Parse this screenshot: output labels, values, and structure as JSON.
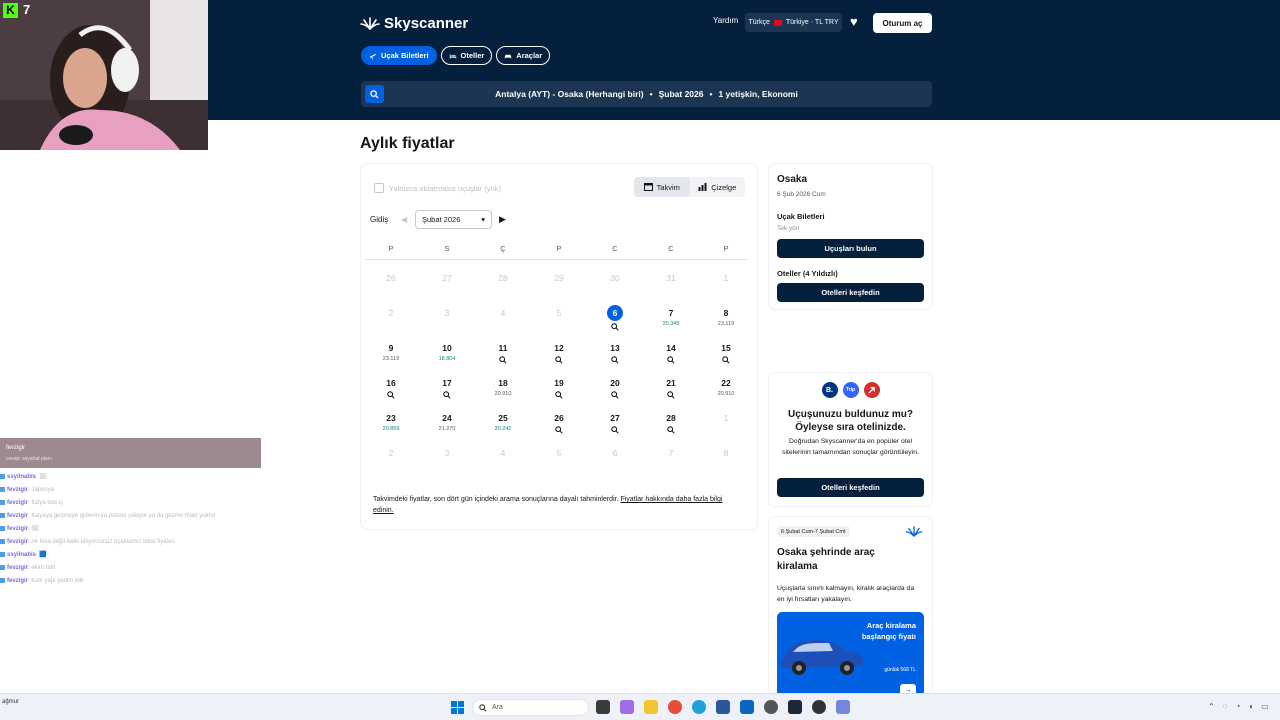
{
  "header": {
    "logo_text": "Skyscanner",
    "help_label": "Yardım",
    "locale_label": "Türkçe",
    "locale_region": "Türkiye · TL TRY",
    "login_label": "Oturum aç",
    "tabs": [
      {
        "label": "Uçak Biletleri",
        "active": true
      },
      {
        "label": "Oteller",
        "active": false
      },
      {
        "label": "Araçlar",
        "active": false
      }
    ],
    "search": {
      "route": "Antalya (AYT) - Osaka (Herhangi biri)",
      "date": "Şubat 2026",
      "travelers": "1 yetişkin, Ekonomi"
    }
  },
  "page_title": "Aylık fiyatlar",
  "calendar": {
    "direct_only_label": "Yalnızca aktarmasız uçuşlar (yok)",
    "view_calendar_label": "Takvim",
    "view_chart_label": "Çizelge",
    "departure_label": "Gidiş",
    "month_value": "Şubat 2026",
    "weekdays": [
      "P",
      "S",
      "Ç",
      "P",
      "C",
      "C",
      "P"
    ],
    "weeks": [
      [
        {
          "d": "26",
          "m": 1
        },
        {
          "d": "27",
          "m": 1
        },
        {
          "d": "28",
          "m": 1
        },
        {
          "d": "29",
          "m": 1
        },
        {
          "d": "30",
          "m": 1
        },
        {
          "d": "31",
          "m": 1
        },
        {
          "d": "1",
          "m": 1
        }
      ],
      [
        {
          "d": "2",
          "m": 1
        },
        {
          "d": "3",
          "m": 1
        },
        {
          "d": "4",
          "m": 1
        },
        {
          "d": "5",
          "m": 1
        },
        {
          "d": "6",
          "s": 1,
          "i": 1
        },
        {
          "d": "7",
          "p": "20.345",
          "c": 1
        },
        {
          "d": "8",
          "p": "23.119"
        }
      ],
      [
        {
          "d": "9",
          "p": "23.119"
        },
        {
          "d": "10",
          "p": "18.804",
          "c": 1
        },
        {
          "d": "11",
          "i": 1
        },
        {
          "d": "12",
          "i": 1
        },
        {
          "d": "13",
          "i": 1
        },
        {
          "d": "14",
          "i": 1
        },
        {
          "d": "15",
          "i": 1
        }
      ],
      [
        {
          "d": "16",
          "i": 1
        },
        {
          "d": "17",
          "i": 1
        },
        {
          "d": "18",
          "p": "20.910"
        },
        {
          "d": "19",
          "i": 1
        },
        {
          "d": "20",
          "i": 1
        },
        {
          "d": "21",
          "i": 1
        },
        {
          "d": "22",
          "p": "20.910"
        }
      ],
      [
        {
          "d": "23",
          "p": "20.859",
          "c": 1
        },
        {
          "d": "24",
          "p": "21.270"
        },
        {
          "d": "25",
          "p": "20.242",
          "c": 1
        },
        {
          "d": "26",
          "i": 1
        },
        {
          "d": "27",
          "i": 1
        },
        {
          "d": "28",
          "i": 1
        },
        {
          "d": "1",
          "m": 1
        }
      ],
      [
        {
          "d": "2",
          "m": 1
        },
        {
          "d": "3",
          "m": 1
        },
        {
          "d": "4",
          "m": 1
        },
        {
          "d": "5",
          "m": 1
        },
        {
          "d": "6",
          "m": 1
        },
        {
          "d": "7",
          "m": 1
        },
        {
          "d": "8",
          "m": 1
        }
      ]
    ],
    "note_text": "Takvimdeki fiyatlar, son dört gün içindeki arama sonuçlarına dayalı tahminlerdir. ",
    "note_link": "Fiyatlar hakkında daha fazla bilgi edinin."
  },
  "info_card": {
    "city": "Osaka",
    "date": "6 Şub 2026 Cum",
    "flights_title": "Uçak Biletleri",
    "flights_sub": "Tek yön",
    "flights_button": "Uçuşları bulun",
    "hotels_title": "Oteller (4 Yıldızlı)",
    "hotels_button": "Otelleri keşfedin"
  },
  "hotel_card": {
    "partner_b": "B.",
    "partner_trip": "Trip",
    "title": "Uçuşunuzu buldunuz mu? Öyleyse sıra otelinizde.",
    "text": "Doğrudan Skyscanner'da en popüler otel sitelerinin tamamından sonuçlar görüntüleyin.",
    "button": "Otelleri keşfedin"
  },
  "car_card": {
    "badge": "6 Şubat Cum-7 Şubat Cmt",
    "title": "Osaka şehrinde araç kiralama",
    "text": "Uçuşlarla sınırlı kalmayın, kiralık araçlarda da en iyi fırsatları yakalayın.",
    "promo_text": "Araç kiralama başlangıç fiyatı",
    "promo_price": "günlük 568 TL"
  },
  "overlay": {
    "viewer_count": "7",
    "chat_head_user": "fevzigir",
    "chat_head_sub": "cevap: seyahat planı",
    "chat": [
      {
        "user": "ssyilnabis",
        "text": ": 🖼"
      },
      {
        "user": "fevzigir",
        "text": ": Japonya"
      },
      {
        "user": "fevzigir",
        "text": ": Italya bos iş"
      },
      {
        "user": "fevzigir",
        "text": ": Italyaya gezmeye gidenin ya potsus çekiyor ya da gezme makt yoktur"
      },
      {
        "user": "fevzigir",
        "text": ": 🖼"
      },
      {
        "user": "fevzigir",
        "text": ": ne kısa değil belki biliyorsunuz uçaktamız bilse fiyaten"
      },
      {
        "user": "ssyilnabis",
        "text": ": 🟦"
      },
      {
        "user": "fevzigir",
        "text": ": ekim tatil"
      },
      {
        "user": "fevzigir",
        "text": ": kum yapı yadim bilir"
      }
    ]
  },
  "taskbar": {
    "left_text": "ağmur",
    "search_placeholder": "Ara"
  },
  "colors": {
    "header_bg": "#05203c",
    "accent": "#0062e3",
    "button_dark": "#05203c",
    "cheap_price": "#0c838a"
  }
}
